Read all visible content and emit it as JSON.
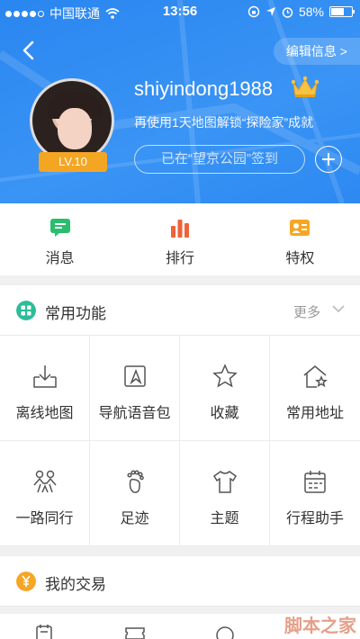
{
  "status": {
    "carrier": "中国联通",
    "time": "13:56",
    "battery": "58%"
  },
  "header": {
    "edit_label": "编辑信息 >",
    "username": "shiyindong1988",
    "level": "LV.10",
    "subtitle": "再使用1天地图解锁“探险家”成就",
    "checkin": "已在“望京公园”签到"
  },
  "tabs": [
    {
      "label": "消息",
      "icon": "message-icon",
      "color": "#2bbd6e"
    },
    {
      "label": "排行",
      "icon": "ranking-icon",
      "color": "#f0623a"
    },
    {
      "label": "特权",
      "icon": "privilege-icon",
      "color": "#f6a623"
    }
  ],
  "common": {
    "title": "常用功能",
    "more": "更多",
    "items": [
      {
        "label": "离线地图",
        "icon": "offline-map-icon"
      },
      {
        "label": "导航语音包",
        "icon": "voice-pack-icon"
      },
      {
        "label": "收藏",
        "icon": "star-icon"
      },
      {
        "label": "常用地址",
        "icon": "home-star-icon"
      },
      {
        "label": "一路同行",
        "icon": "travel-together-icon"
      },
      {
        "label": "足迹",
        "icon": "footprint-icon"
      },
      {
        "label": "主题",
        "icon": "tshirt-icon"
      },
      {
        "label": "行程助手",
        "icon": "calendar-icon"
      }
    ]
  },
  "trade": {
    "title": "我的交易",
    "icon_color": "#f6a623"
  },
  "watermark": "脚本之家"
}
